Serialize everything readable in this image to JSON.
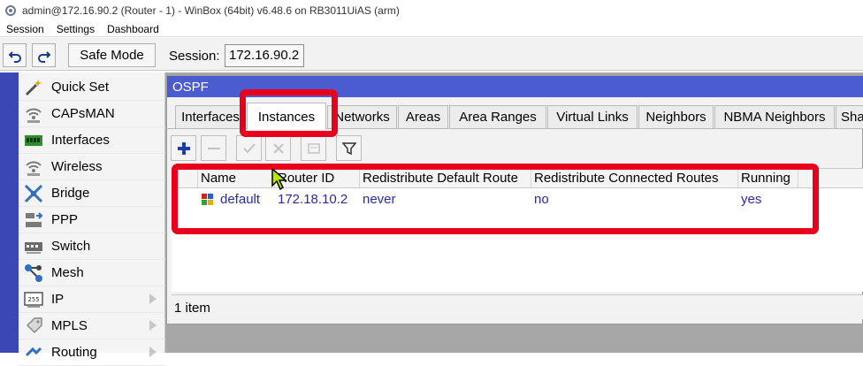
{
  "window_title": "admin@172.16.90.2 (Router - 1) - WinBox (64bit) v6.48.6 on RB3011UiAS (arm)",
  "menu": [
    "Session",
    "Settings",
    "Dashboard"
  ],
  "toolbar": {
    "safe_mode_label": "Safe Mode",
    "session_label": "Session:",
    "session_value": "172.16.90.2"
  },
  "sidebar": {
    "items": [
      {
        "label": "Quick Set",
        "icon": "wand-icon"
      },
      {
        "label": "CAPsMAN",
        "icon": "wifi-icon"
      },
      {
        "label": "Interfaces",
        "icon": "ethernet-card-icon"
      },
      {
        "label": "Wireless",
        "icon": "wifi-icon"
      },
      {
        "label": "Bridge",
        "icon": "bridge-icon"
      },
      {
        "label": "PPP",
        "icon": "ppp-icon"
      },
      {
        "label": "Switch",
        "icon": "switch-icon"
      },
      {
        "label": "Mesh",
        "icon": "mesh-icon"
      },
      {
        "label": "IP",
        "icon": "ip-icon"
      },
      {
        "label": "MPLS",
        "icon": "mpls-icon"
      },
      {
        "label": "Routing",
        "icon": "routing-icon"
      }
    ]
  },
  "ospf_window": {
    "title": "OSPF",
    "tabs": [
      "Interfaces",
      "Instances",
      "Networks",
      "Areas",
      "Area Ranges",
      "Virtual Links",
      "Neighbors",
      "NBMA Neighbors",
      "Sha"
    ],
    "active_tab": "Instances",
    "columns": [
      "Name",
      "Router ID",
      "Redistribute Default Route",
      "Redistribute Connected Routes",
      "Running"
    ],
    "rows": [
      {
        "name": "default",
        "router_id": "172.18.10.2",
        "redistribute_default": "never",
        "redistribute_connected": "no",
        "running": "yes"
      }
    ],
    "status": "1 item"
  },
  "colors": {
    "title_bar": "#4b5cd1",
    "highlight": "#e8001c",
    "sidebar_accent": "#3b47b4",
    "row_text": "#2a2aa8"
  }
}
